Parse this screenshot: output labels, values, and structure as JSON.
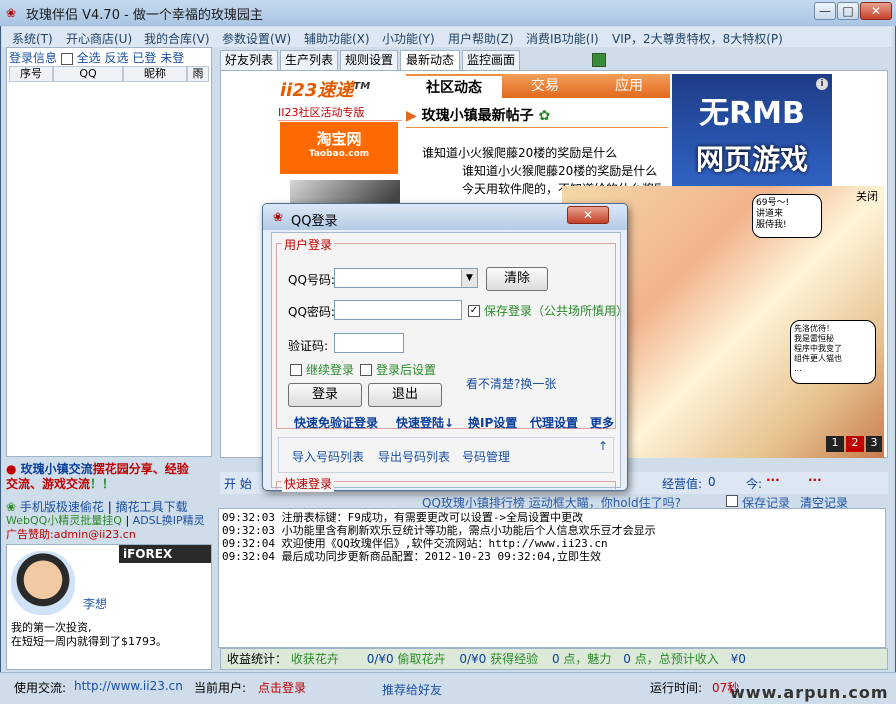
{
  "window": {
    "title": "玫瑰伴侣 V4.70 - 做一个幸福的玫瑰园主",
    "controls": {
      "minimize": "—",
      "maximize": "□",
      "close": "✕"
    }
  },
  "menu": [
    "系统(T)",
    "开心商店(U)",
    "我的合库(V)",
    "参数设置(W)",
    "辅助功能(X)",
    "小功能(Y)",
    "用户帮助(Z)",
    "消费IB功能(I)",
    "VIP，2大尊贵特权，8大特权(P)"
  ],
  "left_panel": {
    "links": "登录信息",
    "select_all": "全选",
    "invert": "反选",
    "logged": "已登",
    "not_logged": "未登",
    "columns": [
      "序号",
      "QQ",
      "昵称",
      "雨"
    ],
    "promo_line1": "玫瑰小镇交流",
    "promo_line1b": "摆花园分享、经验",
    "promo_line2": "交流、游戏交流",
    "promo_line2b": "！！",
    "link_phone": "手机版极速偷花",
    "link_tool": "摘花工具下载",
    "link_webqq": "WebQQ小精灵批量挂Q",
    "link_adsl": "ADSL换IP精灵",
    "ad_label": "广告赞助:admin@ii23.cn",
    "iforex": "iFOREX",
    "person_name": "李想",
    "ad_text1": "我的第一次投资,",
    "ad_text2": "在短短一周内就得到了$1793。"
  },
  "tabs": [
    "好友列表",
    "生产列表",
    "规则设置",
    "最新动态",
    "监控画面"
  ],
  "active_tab": 3,
  "ad_left": {
    "logo": "ii23速递",
    "tm": "TM",
    "subtitle": "II23社区活动专版",
    "taobao": "淘宝网",
    "taobao_sub": "Taobao.com"
  },
  "news": {
    "tabs": [
      "社区动态",
      "交易",
      "应用"
    ],
    "heading": "玫瑰小镇最新帖子",
    "items": [
      "谁知道小火猴爬藤20楼的奖励是什么",
      "谁知道小火猴爬藤20楼的奖励是什么",
      "今天用软件爬的，不知道给的什么奖励"
    ]
  },
  "ad_right": {
    "line1": "无RMB",
    "line2": "网页游戏",
    "close": "关闭",
    "pages": [
      "1",
      "2",
      "3"
    ],
    "bubble1": "69号～!\n讲道来\n服侍我!",
    "bubble2": "先洛优待！\n我是雷恒秘\n程序中我变了\n组件更人猫也\n..."
  },
  "dialog": {
    "title": "QQ登录",
    "close": "✕",
    "user_login": "用户登录",
    "qq_label": "QQ号码:",
    "pwd_label": "QQ密码:",
    "captcha_label": "验证码:",
    "clear_btn": "清除",
    "save_login": "保存登录（公共场所慎用）",
    "continue_login": "继续登录",
    "post_login_settings": "登录后设置",
    "login_btn": "登录",
    "exit_btn": "退出",
    "unclear": "看不清楚?换一张",
    "quick_links": [
      "快速免验证登录",
      "快速登陆↓",
      "换IP设置",
      "代理设置",
      "更多"
    ],
    "import_list": "导入号码列表",
    "export_list": "导出号码列表",
    "manage": "号码管理",
    "arrow_up": "↑",
    "quick_login": "快速登录",
    "qq_value": "",
    "pwd_value": "",
    "captcha_value": ""
  },
  "login_bar": {
    "start": "开 始",
    "exp_label": "经营值:",
    "exp_value": "0",
    "today_label": "今:",
    "dots": "···",
    "dots2": "···"
  },
  "log_header": {
    "marquee": "QQ玫瑰小镇排行榜  运动框大瞄，你hold住了吗?",
    "save_log": "保存记录",
    "clear_log": "清空记录"
  },
  "log_lines": [
    "09:32:03 注册表标键：F9成功，有需要更改可以设置->全局设置中更改",
    "09:32:03 小功能里含有刷新欢乐豆统计等功能，需点小功能后个人信息欢乐豆才会显示",
    "09:32:04 欢迎使用《QQ玫瑰伴侣》,软件交流网站：http://www.ii23.cn",
    "09:32:04 最后成功同步更新商品配置：2012-10-23 09:32:04,立即生效"
  ],
  "stats": {
    "label": "收益统计：",
    "flowers_label": "收获花卉",
    "flowers": "0/¥0",
    "steal_label": "偷取花卉",
    "steal": "0/¥0",
    "exp_label": "获得经验",
    "exp": "0",
    "charm_label": "点，魅力",
    "charm": "0",
    "total_label": "点，总预计收入",
    "total": "¥0"
  },
  "status": {
    "exchange_label": "使用交流:",
    "exchange_url": "http://www.ii23.cn",
    "user_label": "当前用户:",
    "user_value": "点击登录",
    "recommend": "推荐给好友",
    "runtime_label": "运行时间:",
    "runtime_value": "07秒",
    "watermark": "www.arpun.com"
  }
}
